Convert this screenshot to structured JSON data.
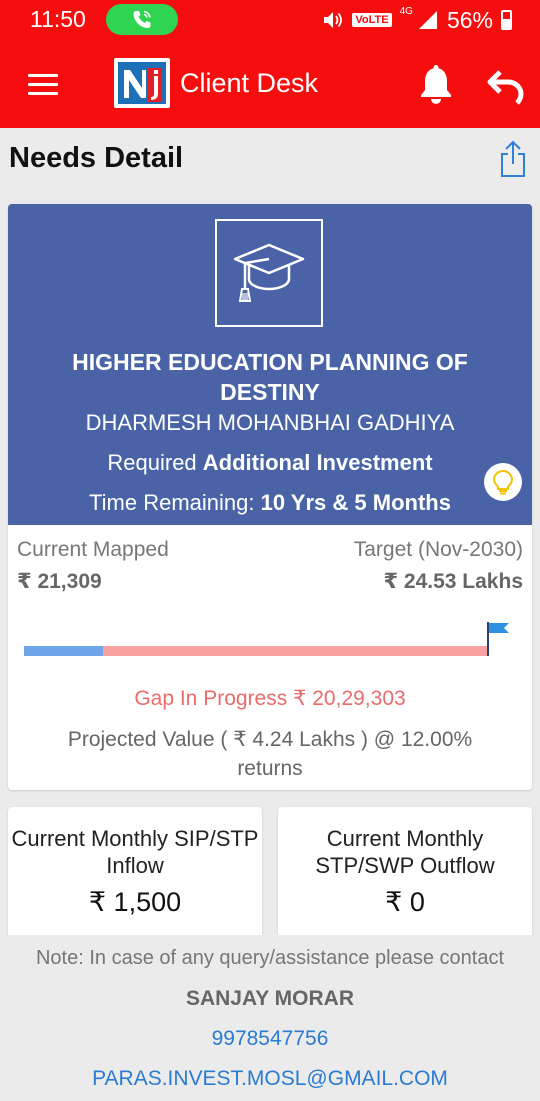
{
  "status_bar": {
    "time": "11:50",
    "network_badge": "VoLTE",
    "network_type": "4G",
    "battery": "56%"
  },
  "app_bar": {
    "title": "Client Desk",
    "logo_text": "Nj"
  },
  "page": {
    "title": "Needs Detail"
  },
  "goal": {
    "icon": "graduation-cap-icon",
    "name": "HIGHER EDUCATION PLANNING OF DESTINY",
    "client_name": "DHARMESH MOHANBHAI GADHIYA",
    "required_prefix": "Required",
    "required_value": "Additional Investment",
    "time_prefix": "Time Remaining:",
    "time_value": "10 Yrs & 5 Months"
  },
  "mapping": {
    "current_label": "Current Mapped",
    "current_value": "₹ 21,309",
    "target_label": "Target (Nov-2030)",
    "target_value": "₹ 24.53 Lakhs",
    "progress_fraction": 0.17
  },
  "gap_text": "Gap In Progress ₹ 20,29,303",
  "projected_text": "Projected Value ( ₹ 4.24 Lakhs ) @ 12.00% returns",
  "inflow": {
    "label": "Current Monthly SIP/STP Inflow",
    "value": "₹ 1,500"
  },
  "outflow": {
    "label": "Current Monthly STP/SWP Outflow",
    "value": "₹ 0"
  },
  "footer": {
    "note": "Note: In case of any query/assistance please contact",
    "contact_name": "SANJAY MORAR",
    "phone": "9978547756",
    "email": "PARAS.INVEST.MOSL@GMAIL.COM"
  },
  "colors": {
    "brand_red": "#f60d0d",
    "card_blue": "#4a63a7",
    "gap_red": "#ec6b6b",
    "link_blue": "#2a7bd1",
    "progress_blue": "#6ea4e8",
    "progress_pink": "#f7a1a1"
  }
}
